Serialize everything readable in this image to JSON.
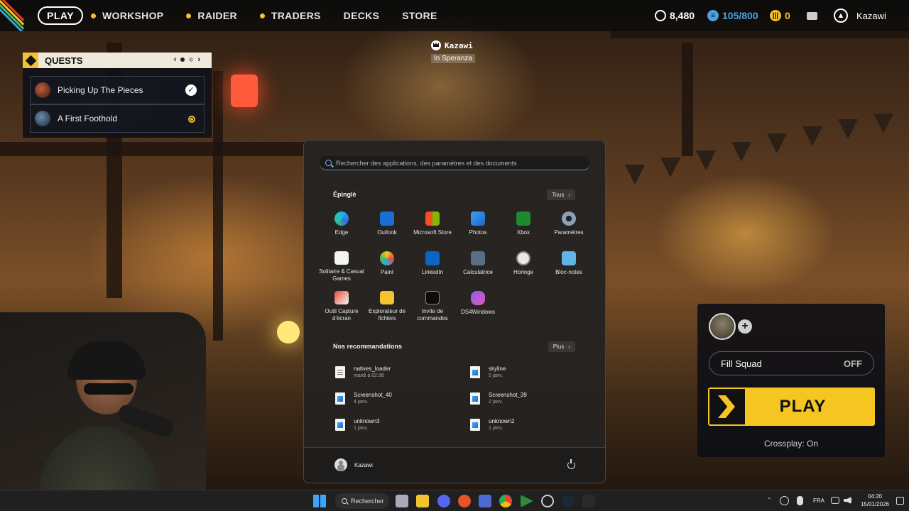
{
  "topbar": {
    "play_label": "PLAY",
    "nav": [
      {
        "label": "WORKSHOP",
        "dot": true
      },
      {
        "label": "RAIDER",
        "dot": true
      },
      {
        "label": "TRADERS",
        "dot": true
      },
      {
        "label": "DECKS",
        "dot": false
      },
      {
        "label": "STORE",
        "dot": false
      }
    ],
    "currency_coins": "8,480",
    "currency_credits": "105/800",
    "currency_tokens": "0",
    "username": "Kazawi",
    "accent": "#f2c230"
  },
  "quests": {
    "title": "QUESTS",
    "items": [
      {
        "label": "Picking Up The Pieces",
        "status": "complete"
      },
      {
        "label": "A First Foothold",
        "status": "in-progress"
      }
    ]
  },
  "player_tag": {
    "name": "Kazawi",
    "location": "In Speranza"
  },
  "squad": {
    "fill_squad_label": "Fill Squad",
    "fill_squad_value": "OFF",
    "play_label": "PLAY",
    "crossplay": "Crossplay: On",
    "play_color": "#f5c522"
  },
  "start_menu": {
    "search_placeholder": "Rechercher des applications, des paramètres et des documents",
    "pinned_title": "Épinglé",
    "pinned_button": "Tous",
    "pinned": [
      {
        "label": "Edge",
        "icon": "edge-icon"
      },
      {
        "label": "Outlook",
        "icon": "outlook-icon"
      },
      {
        "label": "Microsoft Store",
        "icon": "store-icon"
      },
      {
        "label": "Photos",
        "icon": "photos-icon"
      },
      {
        "label": "Xbox",
        "icon": "xbox-icon"
      },
      {
        "label": "Paramètres",
        "icon": "settings-icon"
      },
      {
        "label": "Solitaire & Casual Games",
        "icon": "solitaire-icon"
      },
      {
        "label": "Paint",
        "icon": "paint-icon"
      },
      {
        "label": "LinkedIn",
        "icon": "linkedin-icon"
      },
      {
        "label": "Calculatrice",
        "icon": "calculator-icon"
      },
      {
        "label": "Horloge",
        "icon": "clock-icon"
      },
      {
        "label": "Bloc-notes",
        "icon": "notepad-icon"
      },
      {
        "label": "Outil Capture d'écran",
        "icon": "snipping-tool-icon"
      },
      {
        "label": "Explorateur de fichiers",
        "icon": "file-explorer-icon"
      },
      {
        "label": "Invite de commandes",
        "icon": "command-prompt-icon"
      },
      {
        "label": "DS4Windows",
        "icon": "ds4windows-icon"
      }
    ],
    "recommended_title": "Nos recommandations",
    "recommended_button": "Plus",
    "recommended": [
      {
        "name": "natives_loader",
        "date": "mardi à 02:36",
        "type": "txt"
      },
      {
        "name": "skyline",
        "date": "5 janv.",
        "type": "img"
      },
      {
        "name": "Screenshot_40",
        "date": "4 janv.",
        "type": "img"
      },
      {
        "name": "Screenshot_39",
        "date": "2 janv.",
        "type": "img"
      },
      {
        "name": "unknown3",
        "date": "1 janv.",
        "type": "img"
      },
      {
        "name": "unknown2",
        "date": "1 janv.",
        "type": "img"
      }
    ],
    "user_name": "Kazawi"
  },
  "taskbar": {
    "search_label": "Rechercher",
    "language": "FRA",
    "time": "04:20",
    "date": "15/01/2026"
  }
}
